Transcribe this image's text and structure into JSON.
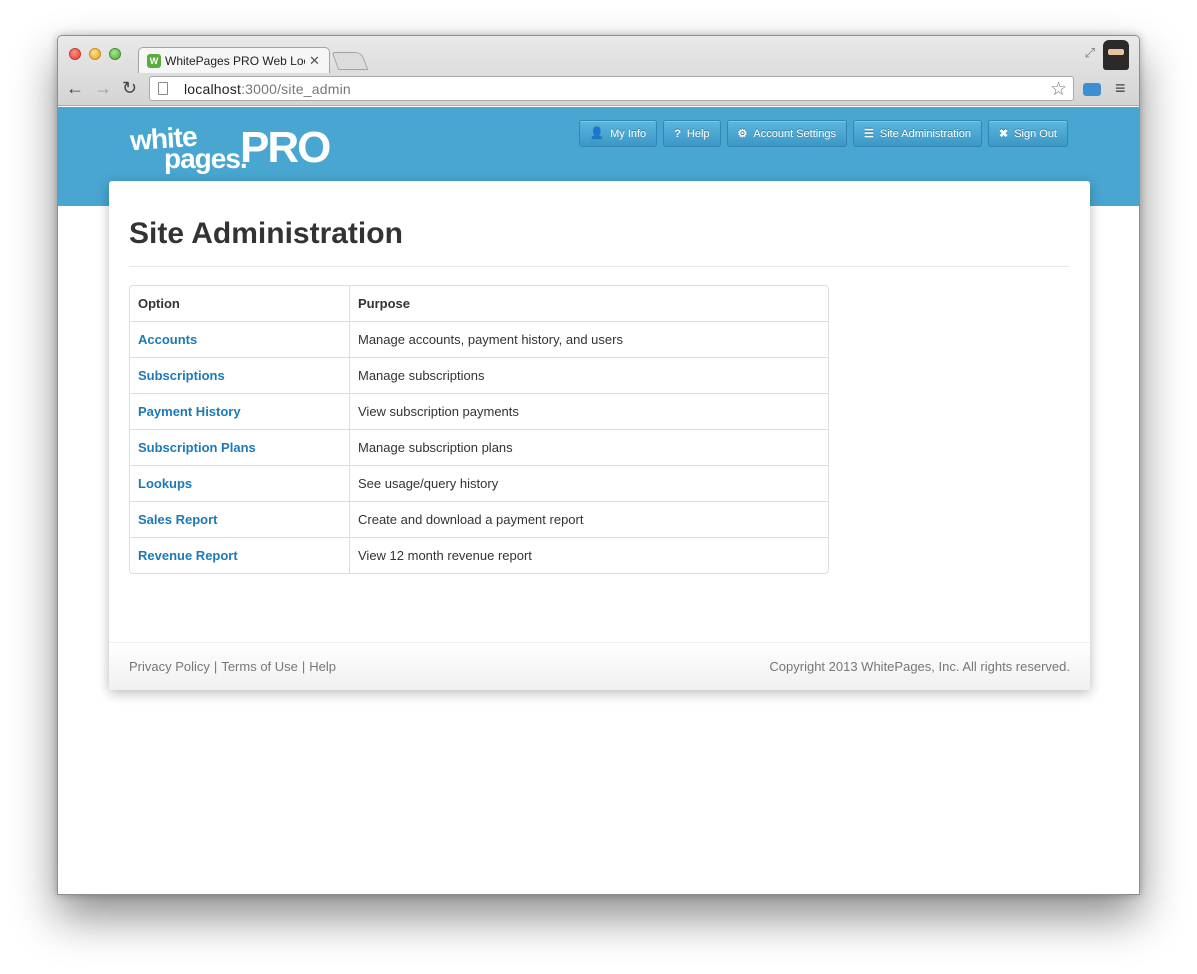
{
  "browser": {
    "tab_title": "WhitePages PRO Web Lookup",
    "tab_favicon": "W",
    "url_host": "localhost",
    "url_path": ":3000/site_admin"
  },
  "brand": {
    "logo_line1": "white",
    "logo_line2": "pages.",
    "logo_pro": "PRO",
    "banner_color": "#48a6d1",
    "link_color": "#1d7ab8"
  },
  "nav": [
    {
      "icon": "user-icon",
      "glyph": "👤",
      "label": "My Info"
    },
    {
      "icon": "help-icon",
      "glyph": "?",
      "label": "Help"
    },
    {
      "icon": "gear-icon",
      "glyph": "⚙",
      "label": "Account Settings"
    },
    {
      "icon": "list-icon",
      "glyph": "☰",
      "label": "Site Administration"
    },
    {
      "icon": "close-icon",
      "glyph": "✖",
      "label": "Sign Out"
    }
  ],
  "page": {
    "title": "Site Administration"
  },
  "table": {
    "headers": [
      "Option",
      "Purpose"
    ],
    "rows": [
      {
        "option": "Accounts",
        "purpose": "Manage accounts, payment history, and users"
      },
      {
        "option": "Subscriptions",
        "purpose": "Manage subscriptions"
      },
      {
        "option": "Payment History",
        "purpose": "View subscription payments"
      },
      {
        "option": "Subscription Plans",
        "purpose": "Manage subscription plans"
      },
      {
        "option": "Lookups",
        "purpose": "See usage/query history"
      },
      {
        "option": "Sales Report",
        "purpose": "Create and download a payment report"
      },
      {
        "option": "Revenue Report",
        "purpose": "View 12 month revenue report"
      }
    ]
  },
  "footer": {
    "links": [
      "Privacy Policy",
      "Terms of Use",
      "Help"
    ],
    "separator": "|",
    "copyright": "Copyright 2013 WhitePages, Inc. All rights reserved."
  }
}
